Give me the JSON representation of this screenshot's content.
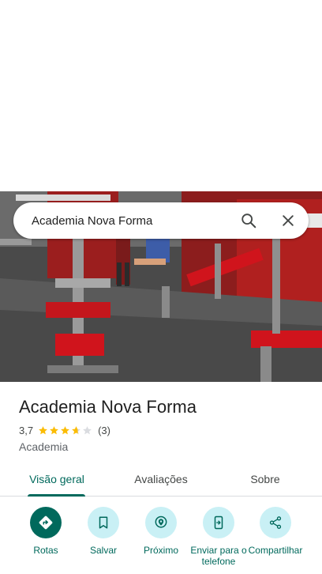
{
  "search": {
    "query": "Academia Nova Forma"
  },
  "place": {
    "name": "Academia Nova Forma",
    "rating": "3,7",
    "stars": 3.7,
    "review_count": "(3)",
    "category": "Academia"
  },
  "tabs": [
    {
      "label": "Visão geral",
      "active": true
    },
    {
      "label": "Avaliações",
      "active": false
    },
    {
      "label": "Sobre",
      "active": false
    }
  ],
  "actions": [
    {
      "label": "Rotas",
      "icon": "directions-icon"
    },
    {
      "label": "Salvar",
      "icon": "bookmark-icon"
    },
    {
      "label": "Próximo",
      "icon": "nearby-icon"
    },
    {
      "label": "Enviar para o telefone",
      "icon": "send-to-phone-icon"
    },
    {
      "label": "Compartilhar",
      "icon": "share-icon"
    }
  ],
  "colors": {
    "accent": "#00695c",
    "action_bg": "#c9f0f5",
    "star": "#fbbc04",
    "star_empty": "#dadce0"
  }
}
